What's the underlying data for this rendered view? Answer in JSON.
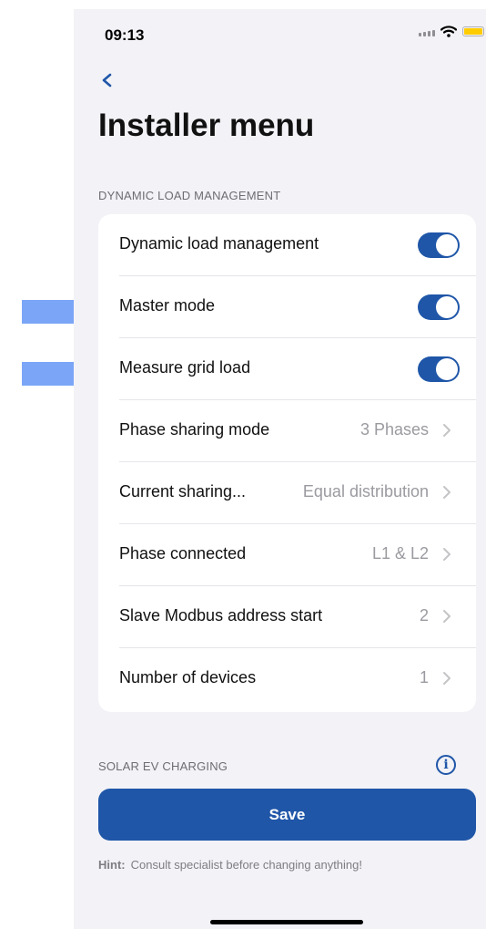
{
  "status_bar": {
    "time": "09:13"
  },
  "page": {
    "title": "Installer menu"
  },
  "sections": {
    "dynamic_load": {
      "header": "DYNAMIC LOAD MANAGEMENT",
      "rows": [
        {
          "label": "Dynamic load management",
          "toggle": true
        },
        {
          "label": "Master mode",
          "toggle": true
        },
        {
          "label": "Measure grid load",
          "toggle": true
        },
        {
          "label": "Phase sharing mode",
          "value": "3 Phases"
        },
        {
          "label": "Current sharing...",
          "value": "Equal distribution"
        },
        {
          "label": "Phase connected",
          "value": "L1 & L2"
        },
        {
          "label": "Slave Modbus address start",
          "value": "2"
        },
        {
          "label": "Number of devices",
          "value": "1"
        }
      ]
    },
    "solar": {
      "header": "SOLAR EV CHARGING"
    }
  },
  "save_button": {
    "label": "Save"
  },
  "hint": {
    "label": "Hint:",
    "text": "Consult specialist before changing anything!"
  },
  "colors": {
    "accent": "#1f56a8",
    "arrow": "#7ba6f7",
    "background": "#f2f2f7"
  }
}
